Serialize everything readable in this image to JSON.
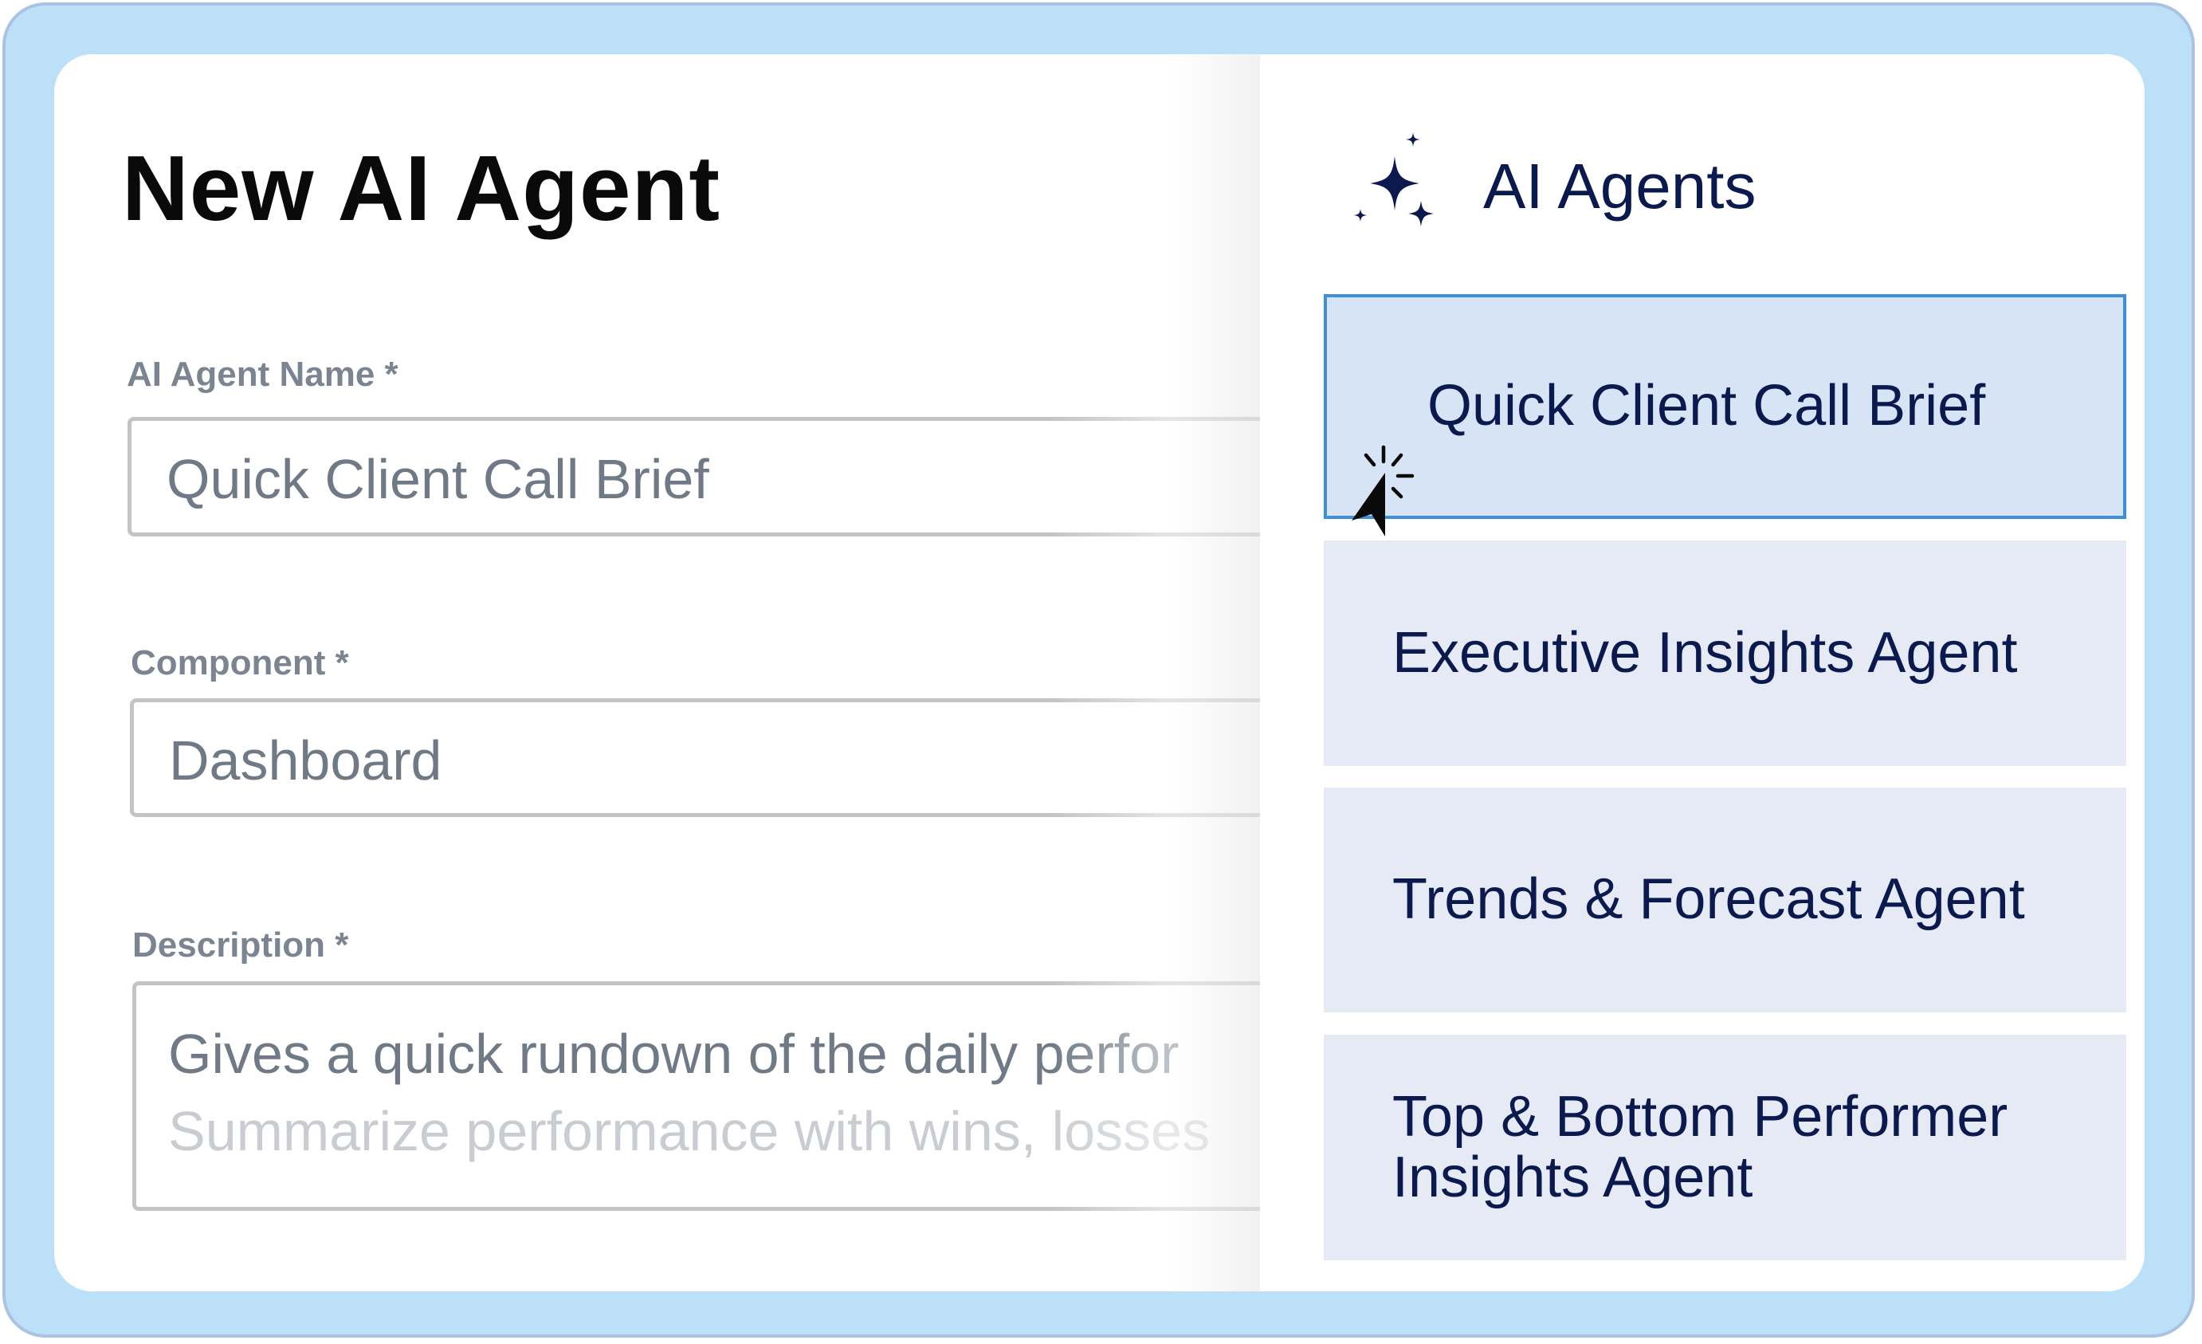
{
  "form": {
    "title": "New AI Agent",
    "name_label": "AI Agent Name *",
    "name_value": "Quick Client Call Brief",
    "component_label": "Component *",
    "component_value": "Dashboard",
    "description_label": "Description *",
    "description_value": "Gives a quick rundown of the daily perfor",
    "description_placeholder": "Summarize performance with wins, losses"
  },
  "panel": {
    "title": "AI Agents",
    "icon": "sparkles-icon",
    "items": [
      {
        "label": "Quick Client Call Brief",
        "selected": true
      },
      {
        "label": "Executive Insights Agent",
        "selected": false
      },
      {
        "label": "Trends & Forecast Agent",
        "selected": false
      },
      {
        "label": "Top & Bottom Performer Insights Agent",
        "selected": false
      }
    ]
  },
  "colors": {
    "frame_bg": "#bde0f9",
    "frame_border": "#aac3e2",
    "item_bg": "#e5eaf4",
    "selected_bg": "#d7e4f5",
    "selected_border": "#3d8fd9",
    "navy_text": "#0b1a4e"
  }
}
